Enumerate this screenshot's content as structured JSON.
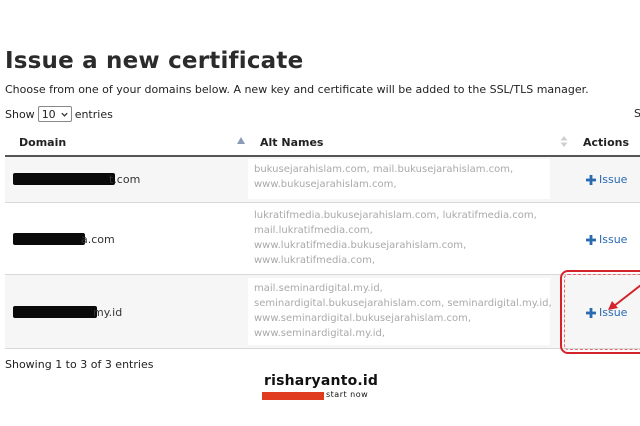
{
  "page": {
    "title": "Issue a new certificate",
    "subtitle": "Choose from one of your domains below. A new key and certificate will be added to the SSL/TLS manager."
  },
  "length_control": {
    "show_label": "Show",
    "selected": "10",
    "entries_label": "entries",
    "search_truncated": "S"
  },
  "table": {
    "columns": [
      "Domain",
      "Alt Names",
      "Actions"
    ],
    "rows": [
      {
        "domain_visible": "t.com",
        "alt_names": [
          "bukusejarahislam.com, mail.bukusejarahislam.com,",
          "www.bukusejarahislam.com,"
        ],
        "action": "Issue"
      },
      {
        "domain_visible": "a.com",
        "alt_names": [
          "lukratifmedia.bukusejarahislam.com, lukratifmedia.com,",
          "mail.lukratifmedia.com,",
          "www.lukratifmedia.bukusejarahislam.com,",
          "www.lukratifmedia.com,"
        ],
        "action": "Issue"
      },
      {
        "domain_visible": "my.id",
        "alt_names": [
          "mail.seminardigital.my.id,",
          "seminardigital.bukusejarahislam.com, seminardigital.my.id,",
          "www.seminardigital.bukusejarahislam.com,",
          "www.seminardigital.my.id,"
        ],
        "action": "Issue"
      }
    ]
  },
  "footer": {
    "info": "Showing 1 to 3 of 3 entries"
  },
  "watermark": {
    "title": "risharyanto.id",
    "tagline": "start now"
  },
  "colors": {
    "link": "#2a6ab0",
    "highlight": "#d4232b",
    "watermark_bar": "#e03a1f"
  },
  "icons": {
    "select_chevron": "chevron-down-icon",
    "sort_asc": "sort-ascending-icon",
    "sort_both": "sort-icon",
    "issue": "plus-icon",
    "pointer": "arrow-icon"
  }
}
